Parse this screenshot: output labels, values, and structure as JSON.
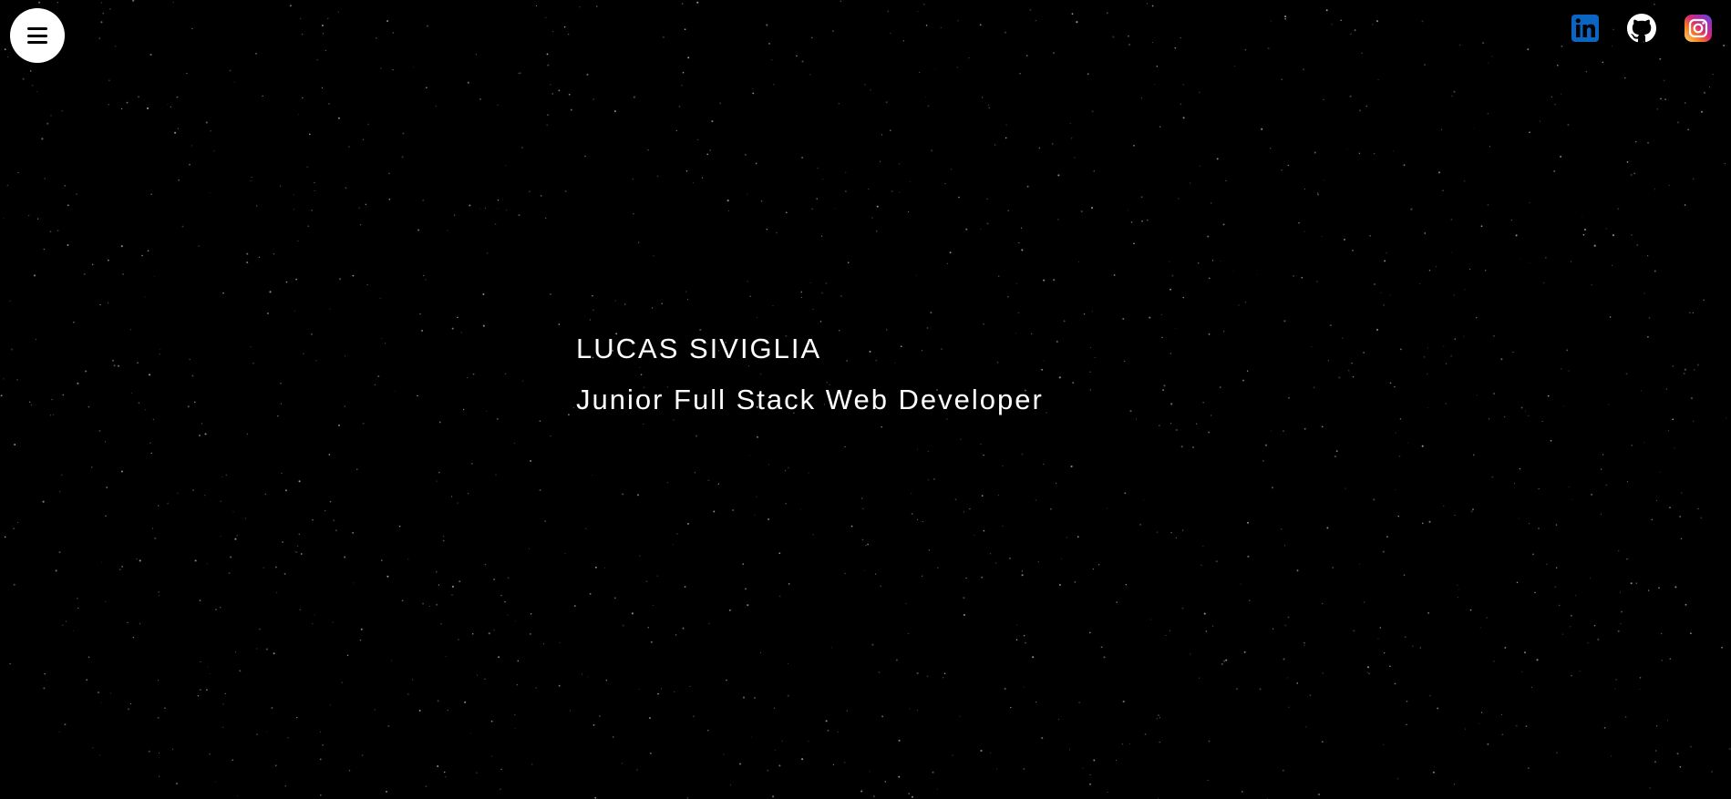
{
  "page": {
    "background_color": "#000000"
  },
  "menu": {
    "icon": "hamburger-icon",
    "button_color": "#ffffff"
  },
  "social_links": [
    {
      "name": "linkedin",
      "icon": "linkedin-icon",
      "color": "#0a66c2"
    },
    {
      "name": "github",
      "icon": "github-icon",
      "color": "#ffffff"
    },
    {
      "name": "instagram",
      "icon": "instagram-icon",
      "colors": [
        "#feda75",
        "#fa7e1e",
        "#d62976",
        "#962fbf",
        "#4f5bd5"
      ]
    }
  ],
  "hero": {
    "name": "LUCAS SIVIGLIA",
    "title": "Junior Full Stack Web Developer",
    "text_color": "#ffffff"
  }
}
